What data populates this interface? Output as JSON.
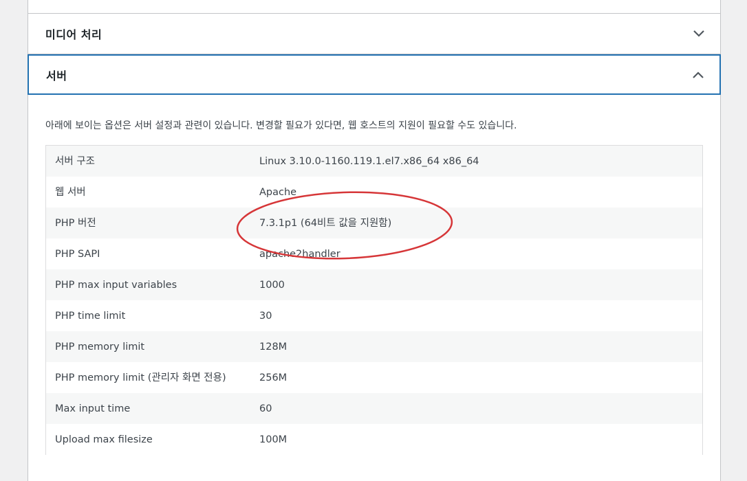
{
  "accordion": {
    "media_title": "미디어 처리",
    "server_title": "서버"
  },
  "server_section": {
    "description": "아래에 보이는 옵션은 서버 설정과 관련이 있습니다. 변경할 필요가 있다면, 웹 호스트의 지원이 필요할 수도 있습니다.",
    "rows": [
      {
        "key": "서버 구조",
        "value": "Linux 3.10.0-1160.119.1.el7.x86_64 x86_64"
      },
      {
        "key": "웹 서버",
        "value": "Apache"
      },
      {
        "key": "PHP 버전",
        "value": "7.3.1p1 (64비트 값을 지원함)"
      },
      {
        "key": "PHP SAPI",
        "value": "apache2handler"
      },
      {
        "key": "PHP max input variables",
        "value": "1000"
      },
      {
        "key": "PHP time limit",
        "value": "30"
      },
      {
        "key": "PHP memory limit",
        "value": "128M"
      },
      {
        "key": "PHP memory limit (관리자 화면 전용)",
        "value": "256M"
      },
      {
        "key": "Max input time",
        "value": "60"
      },
      {
        "key": "Upload max filesize",
        "value": "100M"
      }
    ]
  },
  "colors": {
    "focus_border": "#2271b1",
    "annotation": "#d63638",
    "row_alt": "#f6f7f7"
  },
  "icons": {
    "media_toggle": "chevron-down-icon",
    "server_toggle": "chevron-up-icon"
  }
}
